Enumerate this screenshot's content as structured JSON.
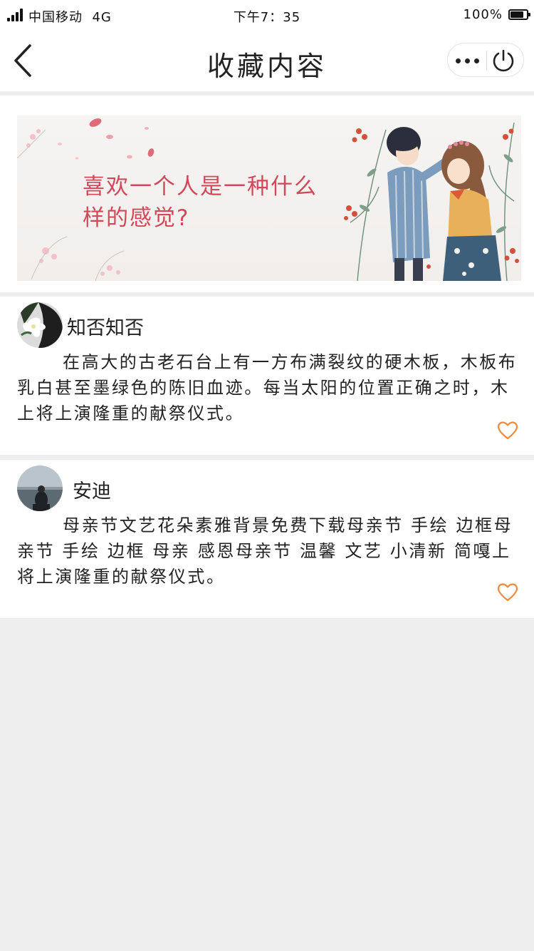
{
  "status_bar": {
    "carrier": "中国移动",
    "network": "4G",
    "time": "下午7：35",
    "battery": "100%"
  },
  "nav": {
    "title": "收藏内容",
    "back_icon": "chevron-left-icon",
    "more_icon": "more-dots-icon",
    "close_icon": "power-icon"
  },
  "banner": {
    "text": "喜欢一个人是一种什么样的感觉?",
    "accent_color": "#d2485a"
  },
  "posts": [
    {
      "author": "知否知否",
      "text": "在高大的古老石台上有一方布满裂纹的硬木板，木板布乳白甚至墨绿色的陈旧血迹。每当太阳的位置正确之时，木上将上演隆重的献祭仪式。",
      "like_icon": "heart-outline-icon"
    },
    {
      "author": "安迪",
      "text": "母亲节文艺花朵素雅背景免费下载母亲节  手绘  边框母亲节 手绘 边框 母亲 感恩母亲节 温馨 文艺 小清新 简嘎上将上演隆重的献祭仪式。",
      "like_icon": "heart-outline-icon"
    }
  ],
  "colors": {
    "like": "#f08a3c",
    "background": "#eeeeee"
  }
}
